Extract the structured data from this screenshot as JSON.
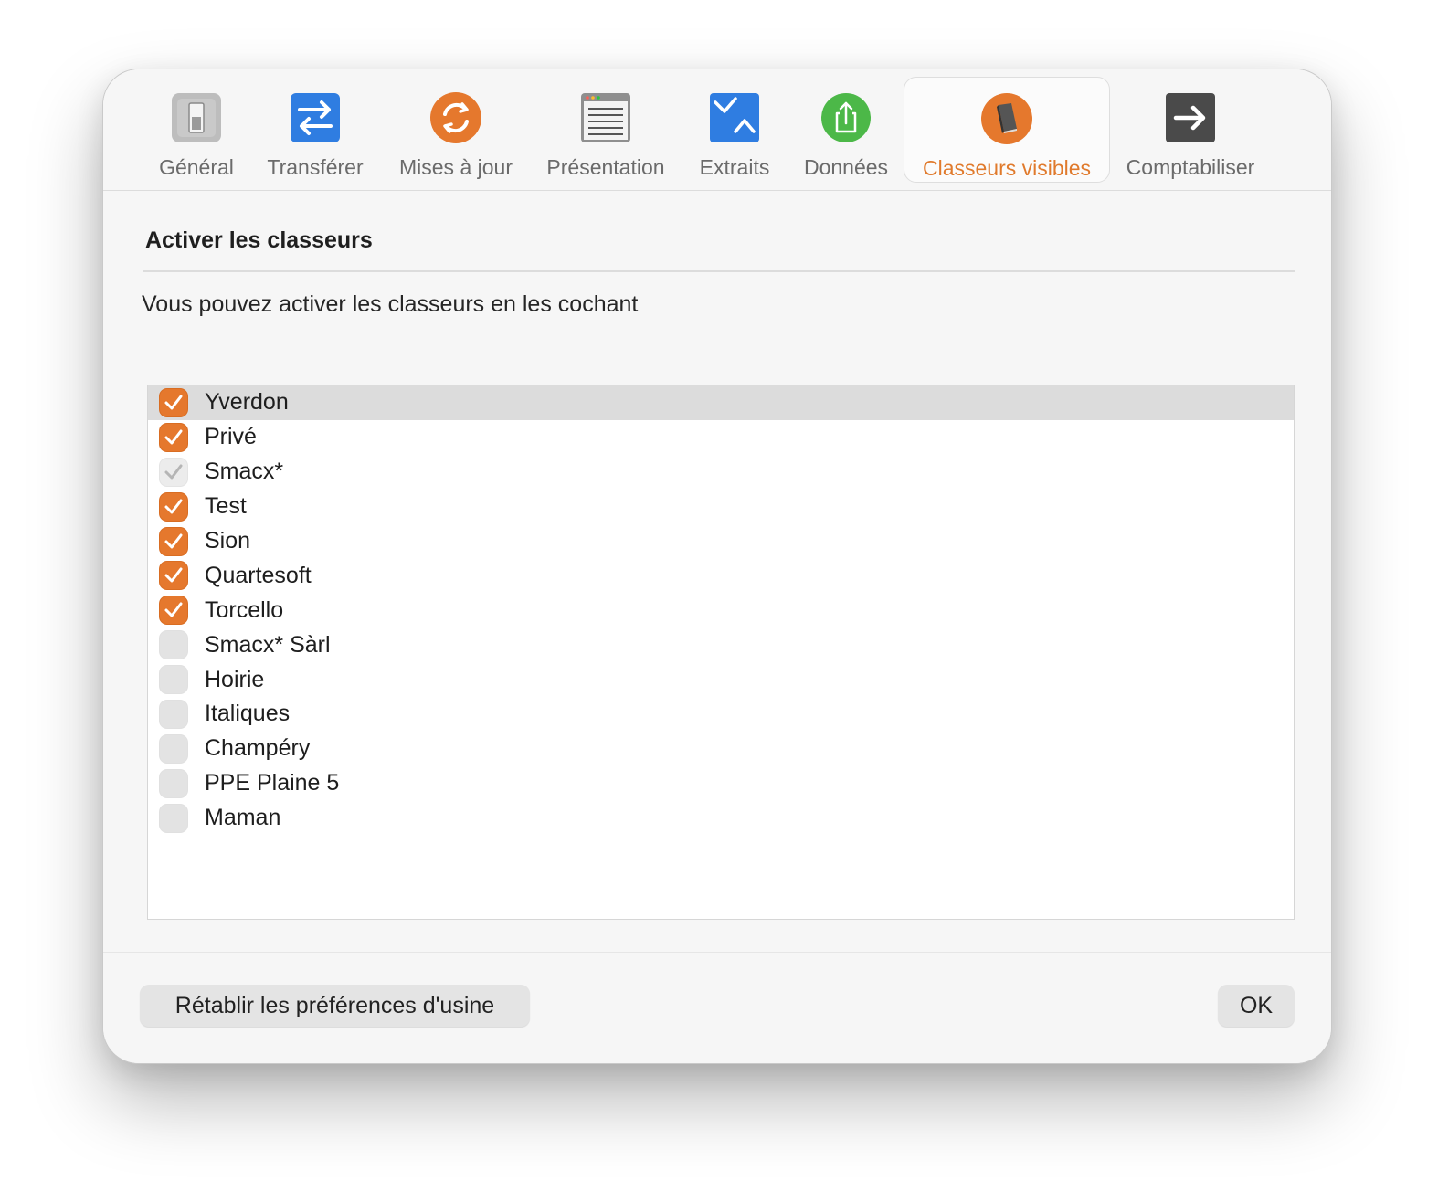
{
  "toolbar": {
    "tabs": [
      {
        "label": "Général",
        "icon": "switch-icon"
      },
      {
        "label": "Transférer",
        "icon": "transfer-arrows-icon"
      },
      {
        "label": "Mises à jour",
        "icon": "refresh-icon"
      },
      {
        "label": "Présentation",
        "icon": "window-list-icon"
      },
      {
        "label": "Extraits",
        "icon": "extracts-icon"
      },
      {
        "label": "Données",
        "icon": "share-upload-icon"
      },
      {
        "label": "Classeurs visibles",
        "icon": "book-icon",
        "selected": true
      },
      {
        "label": "Comptabiliser",
        "icon": "arrow-right-icon"
      }
    ]
  },
  "main": {
    "title": "Activer les classeurs",
    "description": "Vous pouvez activer les classeurs en les cochant",
    "items": [
      {
        "label": "Yverdon",
        "state": "checked",
        "selected": true
      },
      {
        "label": "Privé",
        "state": "checked"
      },
      {
        "label": "Smacx*",
        "state": "mixed"
      },
      {
        "label": "Test",
        "state": "checked"
      },
      {
        "label": "Sion",
        "state": "checked"
      },
      {
        "label": "Quartesoft",
        "state": "checked"
      },
      {
        "label": "Torcello",
        "state": "checked"
      },
      {
        "label": "Smacx* Sàrl",
        "state": "unchecked"
      },
      {
        "label": "Hoirie",
        "state": "unchecked"
      },
      {
        "label": "Italiques",
        "state": "unchecked"
      },
      {
        "label": "Champéry",
        "state": "unchecked"
      },
      {
        "label": "PPE Plaine 5",
        "state": "unchecked"
      },
      {
        "label": "Maman",
        "state": "unchecked"
      }
    ]
  },
  "footer": {
    "reset_label": "Rétablir les préférences d'usine",
    "ok_label": "OK"
  },
  "colors": {
    "accent": "#e5782d",
    "selected_tab_text": "#e07a2c",
    "transfer_blue": "#2f7de1",
    "data_green": "#4cb848"
  }
}
